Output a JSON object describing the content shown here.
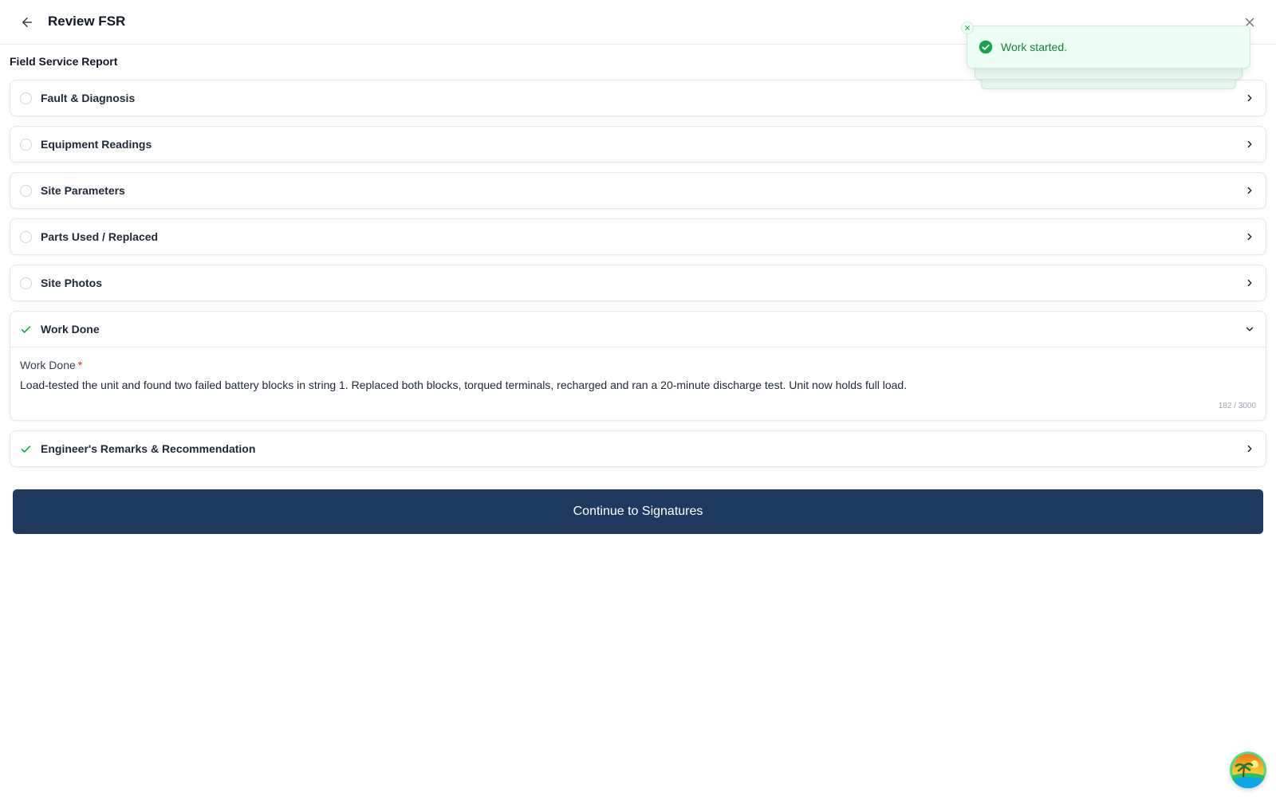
{
  "header": {
    "title": "Review FSR",
    "back_icon": "arrow-left-icon",
    "close_icon": "close-icon"
  },
  "report": {
    "section_title": "Field Service Report",
    "sections": [
      {
        "label": "Fault & Diagnosis",
        "status": "incomplete",
        "expanded": false
      },
      {
        "label": "Equipment Readings",
        "status": "incomplete",
        "expanded": false
      },
      {
        "label": "Site Parameters",
        "status": "incomplete",
        "expanded": false
      },
      {
        "label": "Parts Used / Replaced",
        "status": "incomplete",
        "expanded": false
      },
      {
        "label": "Site Photos",
        "status": "incomplete",
        "expanded": false
      },
      {
        "label": "Work Done",
        "status": "complete",
        "expanded": true
      },
      {
        "label": "Engineer's Remarks & Recommendation",
        "status": "complete",
        "expanded": false
      }
    ],
    "work_done": {
      "field_label": "Work Done",
      "required_mark": "*",
      "value": "Load-tested the unit and found two failed battery blocks in string 1. Replaced both blocks, torqued terminals, recharged and ran a 20-minute discharge test. Unit now holds full load.",
      "char_count": "182 / 3000"
    }
  },
  "actions": {
    "continue_label": "Continue to Signatures"
  },
  "toast": {
    "message": "Work started.",
    "icon": "check-circle-icon",
    "close_icon": "close-icon"
  },
  "colors": {
    "primary": "#1e3a5f",
    "success": "#16a34a",
    "toast_bg": "#ecfdf3",
    "required": "#dc2626"
  }
}
